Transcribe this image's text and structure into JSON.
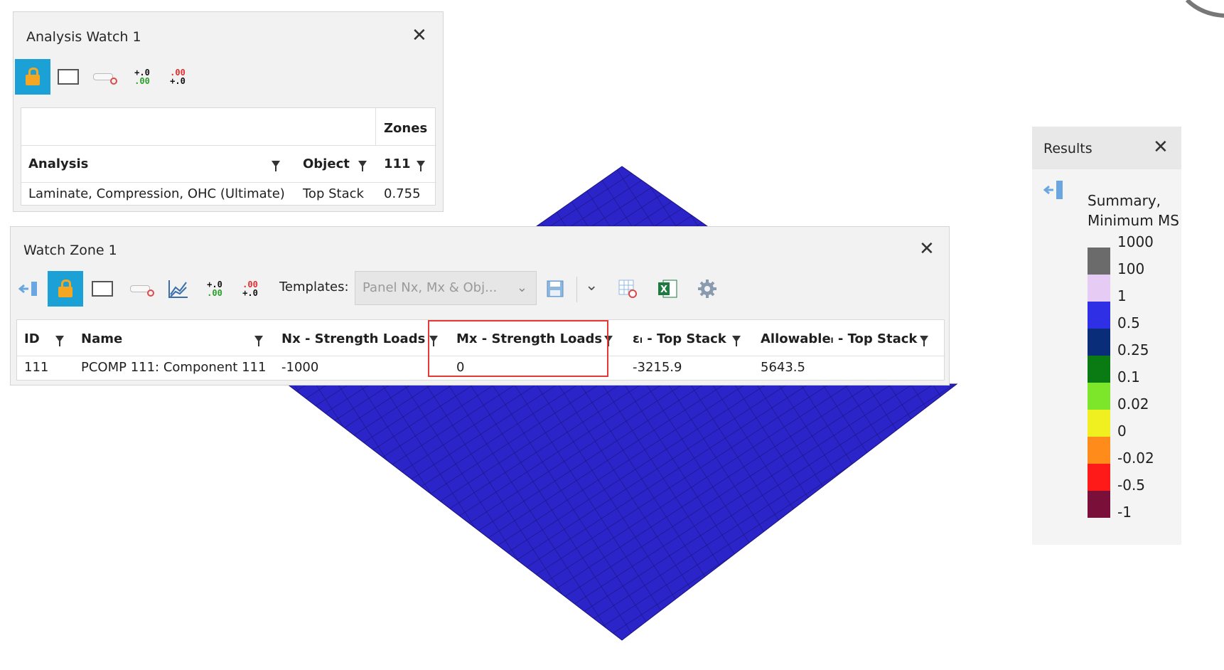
{
  "analysis_watch": {
    "title": "Analysis Watch 1",
    "close": "✕",
    "zones_header": "Zones",
    "columns": [
      "Analysis",
      "Object",
      "111"
    ],
    "row": [
      "Laminate, Compression, OHC (Ultimate)",
      "Top Stack",
      "0.755"
    ]
  },
  "watch_zone": {
    "title": "Watch Zone 1",
    "close": "✕",
    "templates_label": "Templates:",
    "templates_value": "Panel Nx, Mx & Obj...",
    "columns": [
      "ID",
      "Name",
      "Nx - Strength Loads",
      "Mx - Strength Loads",
      "εₗ - Top Stack",
      "Allowableₗ - Top Stack"
    ],
    "row": [
      "111",
      "PCOMP 111: Component 111",
      "-1000",
      "0",
      "-3215.9",
      "5643.5"
    ],
    "highlight_color": "#e53935"
  },
  "results": {
    "title": "Results",
    "close": "✕",
    "legend_title_1": "Summary,",
    "legend_title_2": "Minimum MS",
    "legend_labels": [
      "1000",
      "100",
      "1",
      "0.5",
      "0.25",
      "0.1",
      "0.02",
      "0",
      "-0.02",
      "-0.5",
      "-1"
    ],
    "legend_colors": [
      "#6b6b6b",
      "#e6ccf5",
      "#2f2fe6",
      "#0a2d7a",
      "#0a7a12",
      "#7ee62a",
      "#f0f020",
      "#ff8c1a",
      "#ff1a1a",
      "#7a0f3a"
    ]
  },
  "mesh_color": "#2b24c9",
  "icons": {
    "lock": "lock-icon",
    "select": "select-rect-icon",
    "toggle": "toggle-off-icon",
    "add_decimal": "increase-decimal-icon",
    "remove_decimal": "decrease-decimal-icon",
    "chart": "chart-icon",
    "save": "save-icon",
    "excel": "excel-icon",
    "gear": "gear-icon",
    "pin": "pin-left-icon",
    "grid_remove": "grid-remove-icon"
  },
  "decimal_icon_text": {
    "add_top": "+.0",
    "add_bottom": ".00",
    "remove_top": ".00",
    "remove_bottom": "+.0"
  }
}
